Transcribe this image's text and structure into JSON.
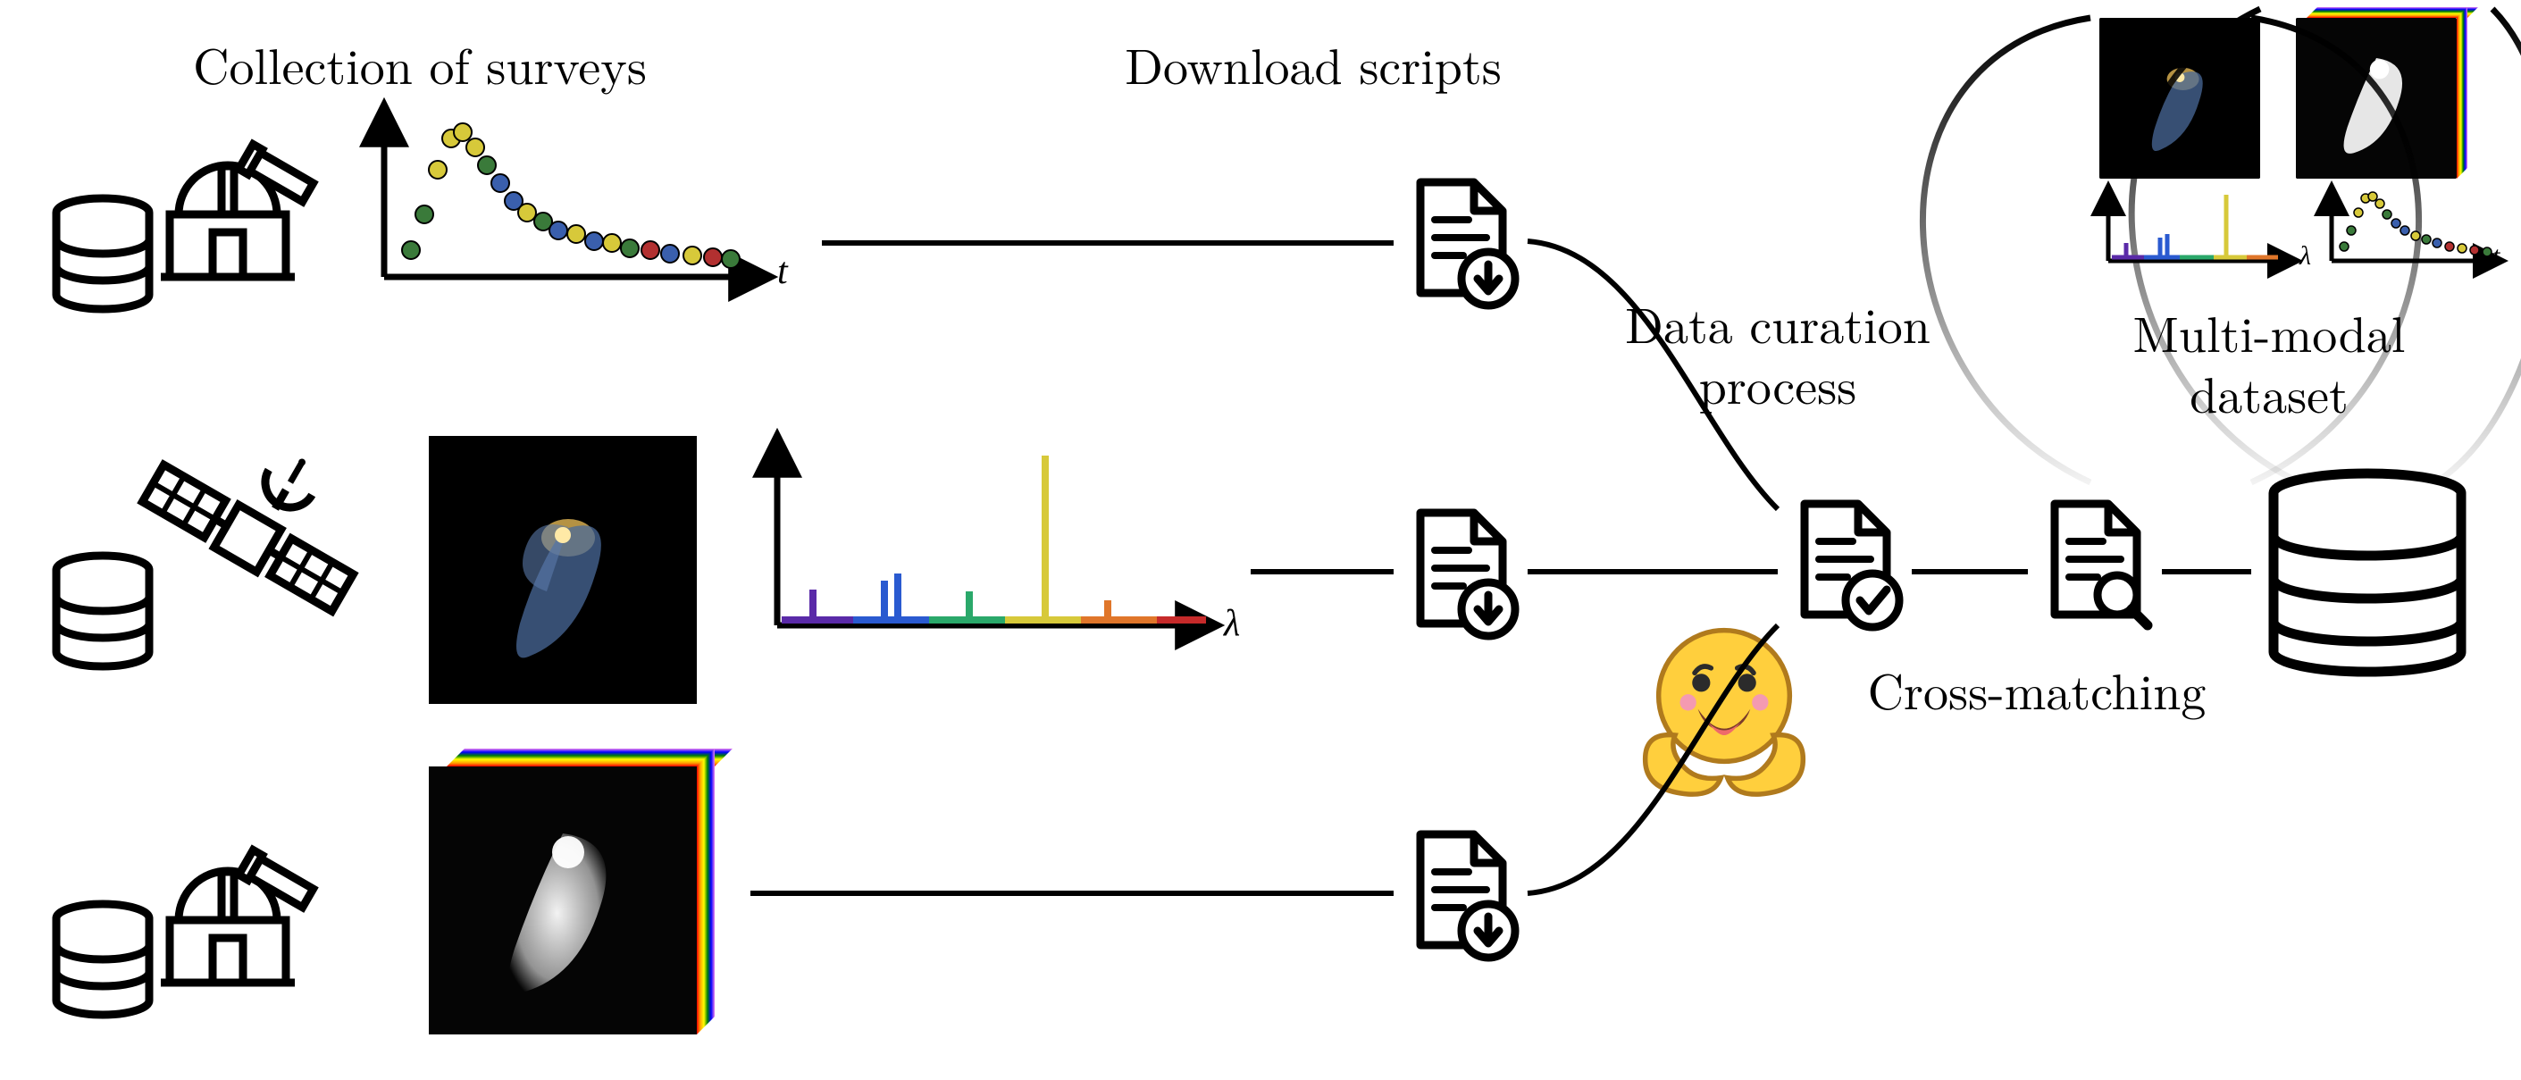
{
  "labels": {
    "collection": "Collection of surveys",
    "download": "Download scripts",
    "curation_l1": "Data curation",
    "curation_l2": "process",
    "crossmatch": "Cross-matching",
    "mm_l1": "Multi-modal",
    "mm_l2": "dataset"
  },
  "axes": {
    "time": "t",
    "wavelength": "λ"
  },
  "icons": {
    "db": "database-icon",
    "obs": "observatory-icon",
    "sat": "satellite-icon",
    "file_dl": "file-download-icon",
    "file_check": "file-check-icon",
    "file_search": "file-search-icon",
    "hf": "huggingface-icon"
  }
}
